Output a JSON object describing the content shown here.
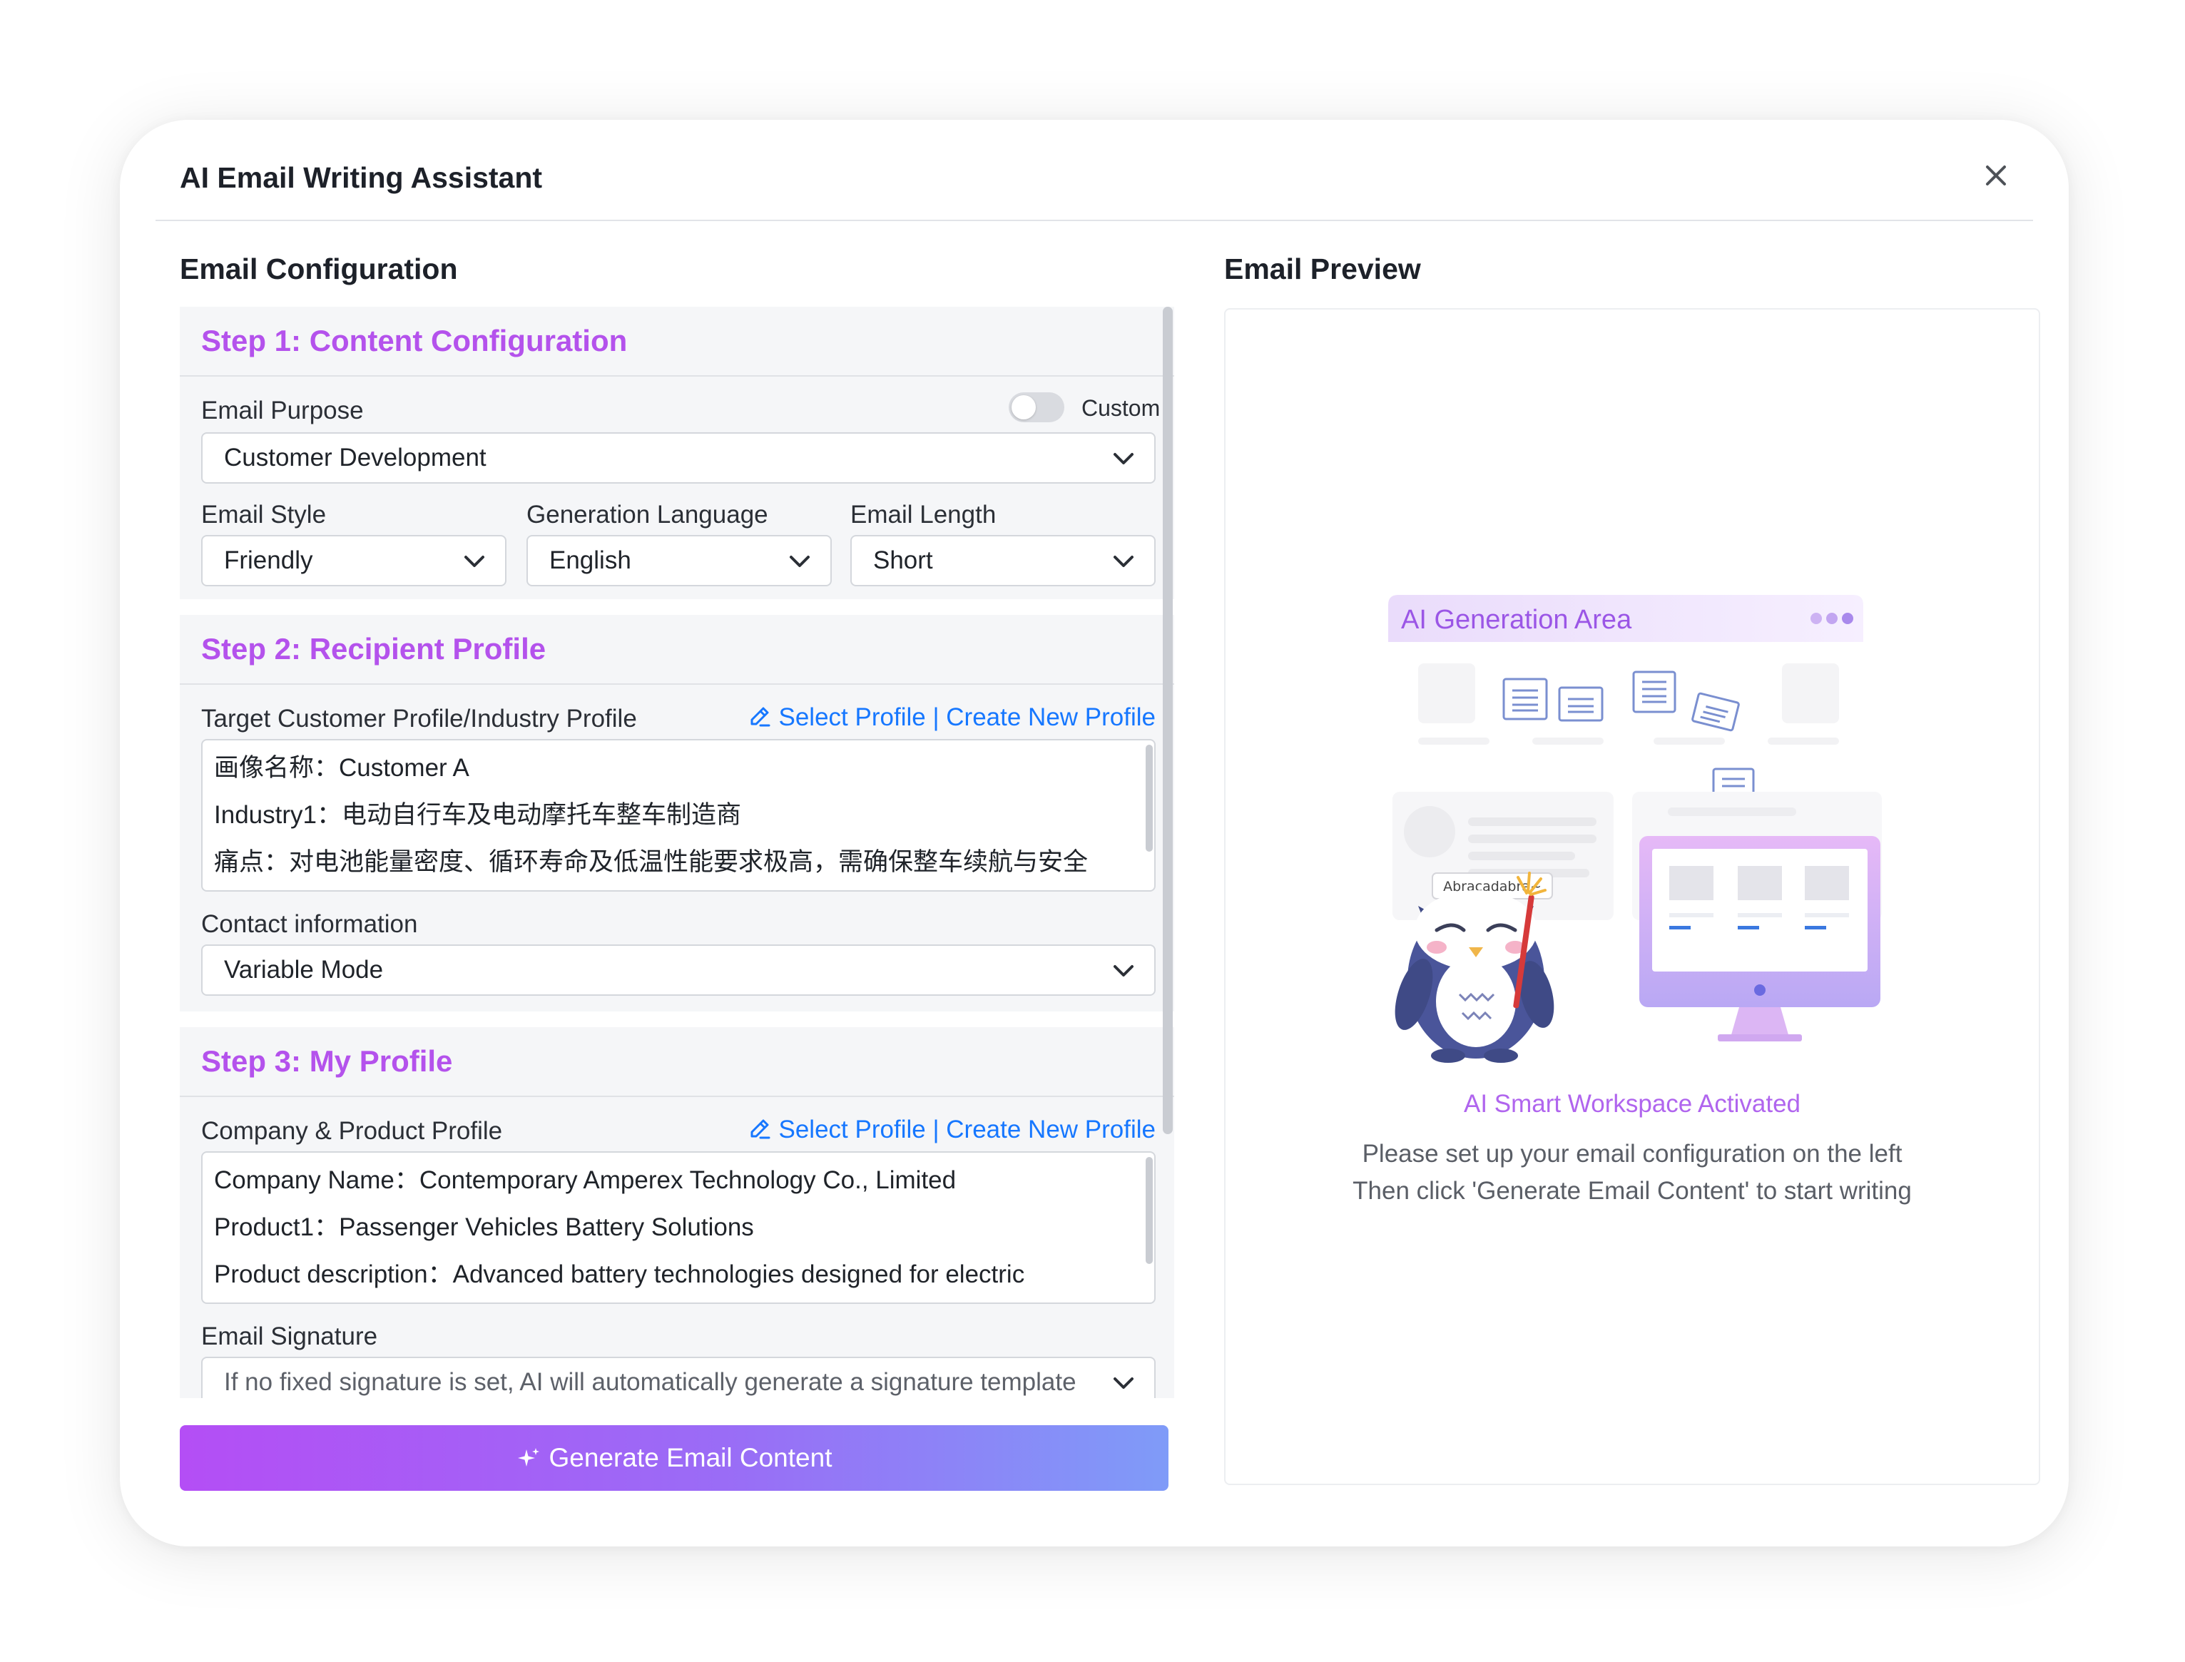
{
  "modal": {
    "title": "AI Email Writing Assistant"
  },
  "config": {
    "section_title": "Email Configuration",
    "step1": {
      "title": "Step 1: Content Configuration",
      "purpose_label": "Email Purpose",
      "custom_label": "Custom",
      "custom_enabled": false,
      "purpose_value": "Customer Development",
      "style_label": "Email Style",
      "style_value": "Friendly",
      "language_label": "Generation Language",
      "language_value": "English",
      "length_label": "Email Length",
      "length_value": "Short"
    },
    "step2": {
      "title": "Step 2: Recipient Profile",
      "profile_label": "Target Customer Profile/Industry Profile",
      "select_profile": "Select Profile",
      "separator": " | ",
      "create_profile": "Create New Profile",
      "profile_lines": [
        "画像名称：Customer A",
        "Industry1：电动自行车及电动摩托车整车制造商",
        "痛点：对电池能量密度、循环寿命及低温性能要求极高，需确保整车续航与安全"
      ],
      "contact_label": "Contact information",
      "contact_value": "Variable Mode"
    },
    "step3": {
      "title": "Step 3: My Profile",
      "profile_label": "Company & Product Profile",
      "select_profile": "Select Profile",
      "separator": " | ",
      "create_profile": "Create New Profile",
      "profile_lines": [
        "Company Name：Contemporary Amperex Technology Co., Limited",
        "Product1：Passenger Vehicles Battery Solutions",
        "Product description：Advanced battery technologies designed for electric"
      ],
      "signature_label": "Email Signature",
      "signature_value": "If no fixed signature is set, AI will automatically generate a signature template"
    },
    "generate_button": "Generate Email Content"
  },
  "preview": {
    "section_title": "Email Preview",
    "area_title": "AI Generation Area",
    "bubble_text": "Abracadabra~",
    "activated": "AI Smart Workspace Activated",
    "hint_line1": "Please set up your email configuration on the left",
    "hint_line2": "Then click 'Generate Email Content' to start writing"
  },
  "colors": {
    "accent": "#b452ec",
    "link": "#1677ff",
    "button_gradient_start": "#b44ef5",
    "button_gradient_end": "#7f9bf8"
  },
  "icons": {
    "close": "close-icon",
    "chevron": "chevron-down-icon",
    "edit": "edit-icon",
    "sparkle": "sparkle-icon"
  }
}
